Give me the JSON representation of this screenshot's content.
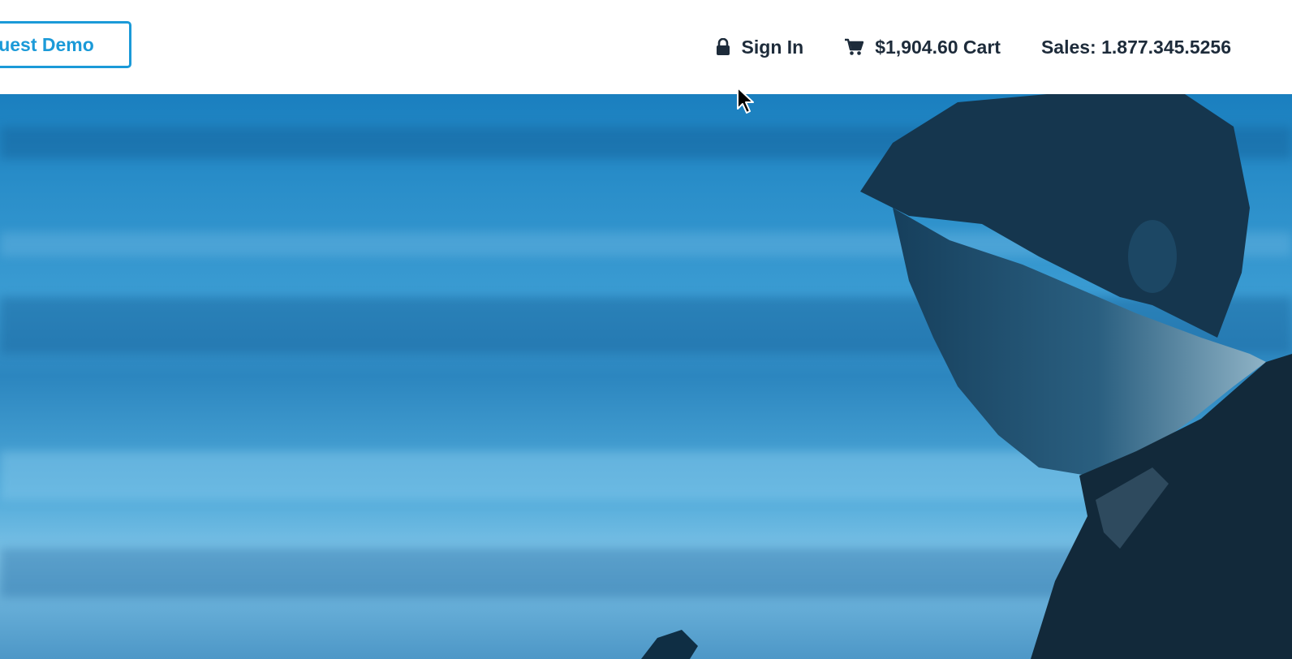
{
  "header": {
    "demo_button_label": "quest Demo",
    "sign_in_label": "Sign In",
    "cart_label": "$1,904.60 Cart",
    "sales_label": "Sales: 1.877.345.5256"
  },
  "icons": {
    "sign_in": "lock-icon",
    "cart": "cart-icon"
  },
  "colors": {
    "accent": "#1b9ad8",
    "nav_text": "#1d2b3a",
    "hero_blue": "#2b8fca"
  },
  "hero": {
    "image": "man-looking-at-phone-photo"
  }
}
